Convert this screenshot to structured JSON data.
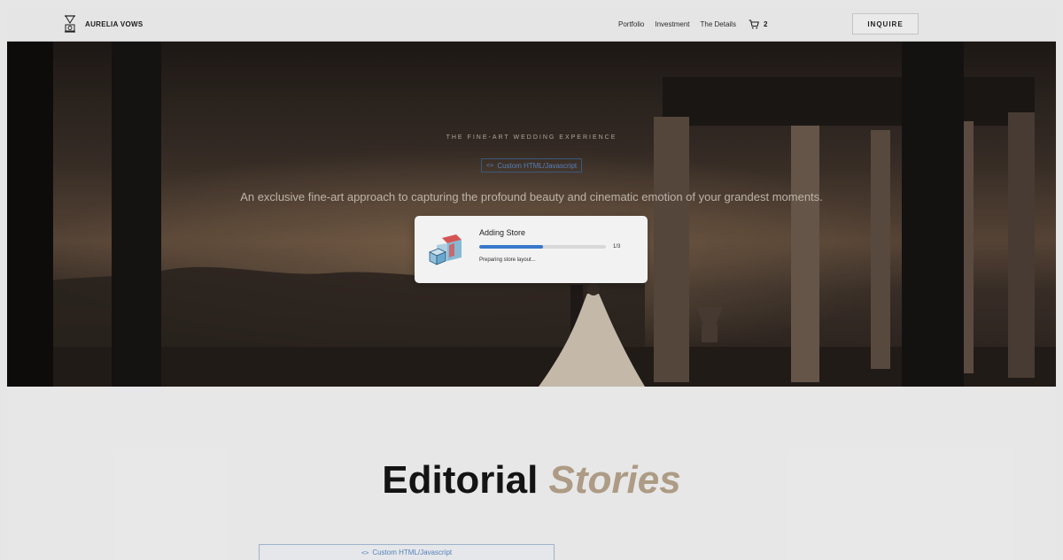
{
  "brand": {
    "name": "AURELIA VOWS",
    "logo_icon": "hourglass-camera-icon"
  },
  "nav": {
    "items": [
      "Portfolio",
      "Investment",
      "The Details"
    ],
    "cart_icon": "cart-icon",
    "cart_count": "2",
    "cta_label": "INQUIRE"
  },
  "hero": {
    "eyebrow": "THE FINE-ART WEDDING EXPERIENCE",
    "embed_label": "Custom HTML/Javascript",
    "embed_icon": "code-brackets-icon",
    "tagline": "An exclusive fine-art approach to capturing the profound beauty and cinematic emotion of your grandest moments."
  },
  "modal": {
    "icon": "store-box-icon",
    "title": "Adding Store",
    "progress": 0.5,
    "progress_count": "1/3",
    "status": "Preparing store layout..."
  },
  "section": {
    "title_main": "Editorial",
    "title_accent": "Stories",
    "embed_label": "Custom HTML/Javascript"
  },
  "colors": {
    "accent_gold": "#b7a48d",
    "link_blue": "#5b87c2",
    "progress_blue": "#3d7fd6"
  }
}
